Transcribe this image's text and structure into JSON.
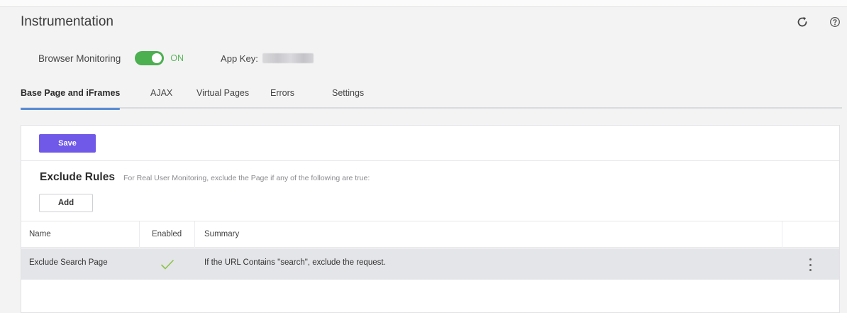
{
  "page": {
    "title": "Instrumentation"
  },
  "header_icons": [
    "refresh-icon",
    "help-icon"
  ],
  "browser_monitoring": {
    "label": "Browser Monitoring",
    "toggle_state": "ON",
    "enabled": true,
    "app_key_label": "App Key:"
  },
  "tabs": [
    {
      "label": "Base Page and iFrames",
      "active": true
    },
    {
      "label": "AJAX",
      "active": false
    },
    {
      "label": "Virtual Pages",
      "active": false
    },
    {
      "label": "Errors",
      "active": false
    },
    {
      "label": "Settings",
      "active": false
    }
  ],
  "panel": {
    "save_label": "Save",
    "rules_title": "Exclude Rules",
    "rules_description": "For Real User Monitoring, exclude the Page if any of the following are true:",
    "add_label": "Add"
  },
  "table": {
    "columns": [
      "Name",
      "Enabled",
      "Summary"
    ],
    "rows": [
      {
        "name": "Exclude Search Page",
        "enabled": true,
        "summary": "If the URL Contains \"search\", exclude the request."
      }
    ]
  },
  "colors": {
    "accent": "#7058e8",
    "toggle_on": "#4caf50",
    "tab_underline": "#5b8fd6",
    "check": "#8bc34a"
  }
}
